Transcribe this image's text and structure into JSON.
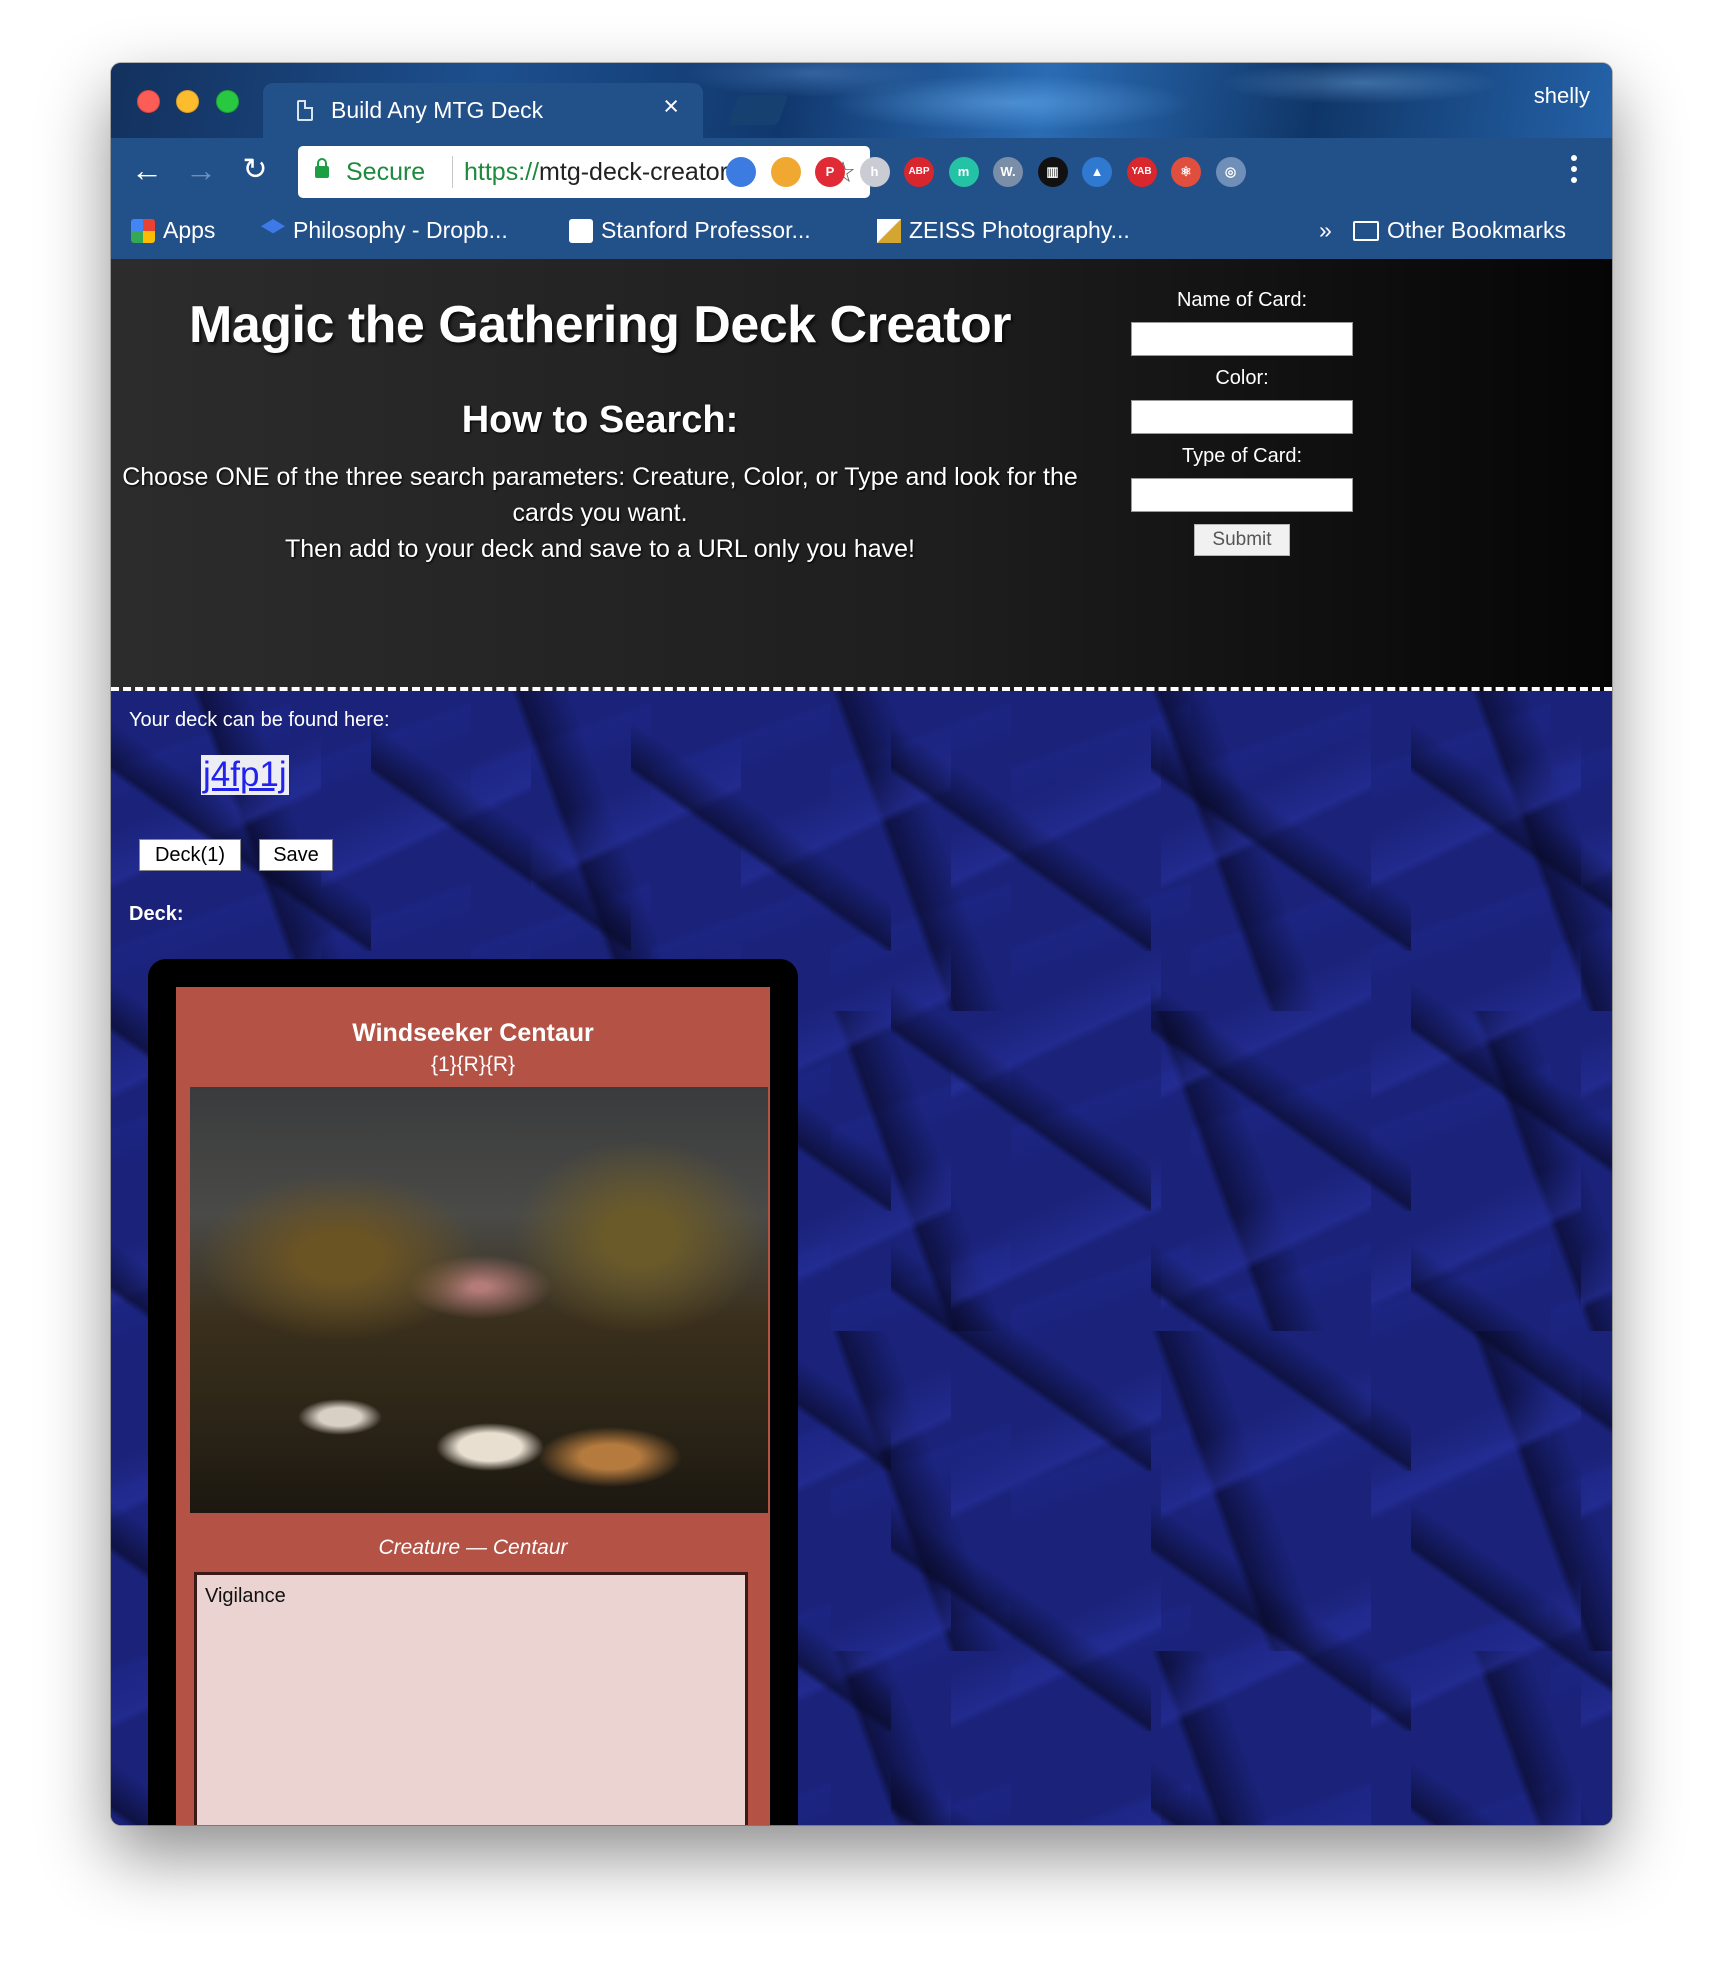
{
  "browser": {
    "tab_title": "Build Any MTG Deck",
    "tab_close": "×",
    "profile": "shelly",
    "secure_label": "Secure",
    "url_scheme": "https://",
    "url_rest": "mtg-deck-creator...",
    "bookmarks": [
      {
        "label": "Apps",
        "icon": "apps-grid-icon"
      },
      {
        "label": "Philosophy - Dropb...",
        "icon": "dropbox-icon"
      },
      {
        "label": "Stanford Professor...",
        "icon": "photo-icon"
      },
      {
        "label": "ZEISS Photography...",
        "icon": "zeiss-icon"
      }
    ],
    "bookmarks_overflow": "»",
    "other_bookmarks": "Other Bookmarks",
    "extensions": [
      {
        "name": "tick-ext-icon",
        "color": "#3c7ce0",
        "label": ""
      },
      {
        "name": "colorful-ext-icon",
        "color": "#f0a830",
        "label": ""
      },
      {
        "name": "pinterest-icon",
        "color": "#e02a35",
        "label": "P"
      },
      {
        "name": "hackpad-icon",
        "color": "#c9ccd2",
        "label": "h"
      },
      {
        "name": "adblock-plus-icon",
        "color": "#d9262e",
        "label": "ABP"
      },
      {
        "name": "mercury-icon",
        "color": "#25c3a6",
        "label": "m"
      },
      {
        "name": "wordpress-icon",
        "color": "#7a8ea8",
        "label": "W."
      },
      {
        "name": "archive-icon",
        "color": "#111111",
        "label": "▥"
      },
      {
        "name": "kylo-icon",
        "color": "#2f7ad0",
        "label": "▲"
      },
      {
        "name": "yab-icon",
        "color": "#d8282e",
        "label": "YAB"
      },
      {
        "name": "react-devtools-icon",
        "color": "#e04e3e",
        "label": "⚛"
      },
      {
        "name": "target-icon",
        "color": "#6f8fb8",
        "label": "◎"
      }
    ]
  },
  "header": {
    "title": "Magic the Gathering Deck Creator",
    "howto_heading": "How to Search:",
    "instructions_line1": "Choose ONE of the three search parameters: Creature, Color, or Type and look for the cards you want.",
    "instructions_line2": "Then add to your deck and save to a URL only you have!"
  },
  "search_form": {
    "name_label": "Name of Card:",
    "color_label": "Color:",
    "type_label": "Type of Card:",
    "submit_label": "Submit"
  },
  "deck": {
    "found_label": "Your deck can be found here:",
    "link_text": "j4fp1j",
    "deck_button": "Deck(1)",
    "save_button": "Save",
    "deck_heading": "Deck:",
    "card": {
      "name": "Windseeker Centaur",
      "cost": "{1}{R}{R}",
      "type_line": "Creature — Centaur",
      "rules_text": "Vigilance",
      "frame_color": "#b35245"
    }
  }
}
